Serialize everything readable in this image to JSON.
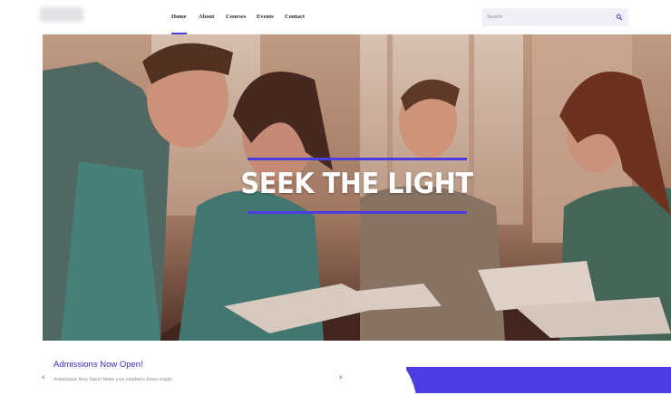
{
  "nav": {
    "items": [
      {
        "label": "Home"
      },
      {
        "label": "About"
      },
      {
        "label": "Courses"
      },
      {
        "label": "Events"
      },
      {
        "label": "Contact"
      }
    ]
  },
  "search": {
    "placeholder": "Search"
  },
  "hero": {
    "title": "SEEK THE LIGHT"
  },
  "caption": {
    "title": "Admissions Now Open!",
    "text": "Admissions Now Open! Make your children's future bright."
  },
  "arrows": {
    "prev": "‹",
    "next": "›"
  },
  "colors": {
    "accent": "#4b3de0"
  }
}
